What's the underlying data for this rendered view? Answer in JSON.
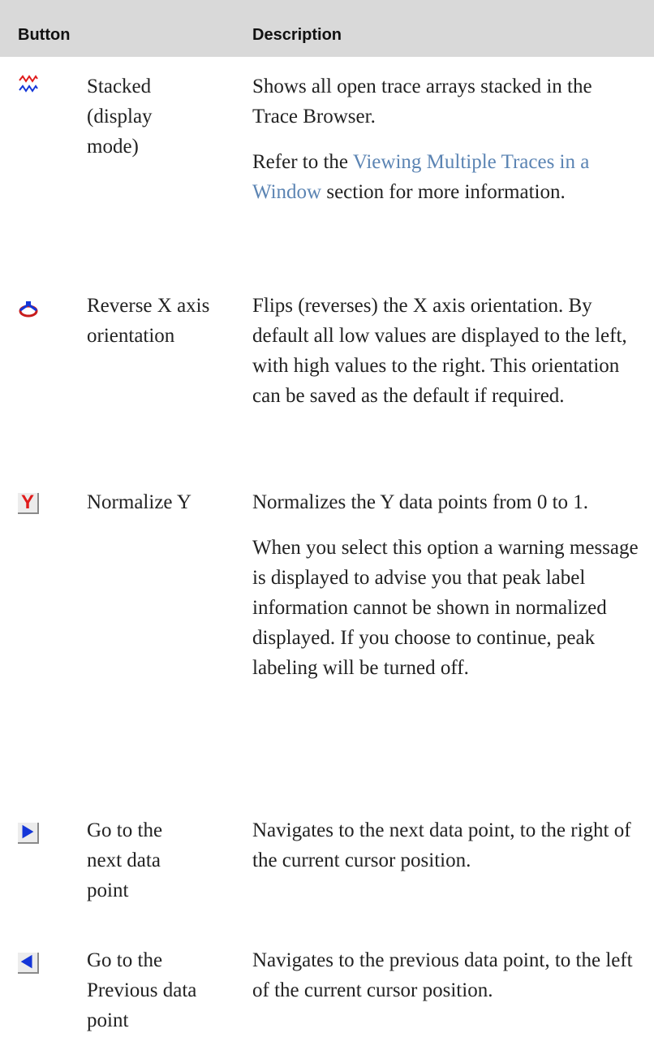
{
  "header": {
    "button": "Button",
    "description": "Description"
  },
  "rows": [
    {
      "icon": "stacked-waves-icon",
      "name_lines": [
        "Stacked",
        "(display",
        "mode)"
      ],
      "desc": [
        "Shows all open trace arrays stacked in the Trace Browser.",
        {
          "before": "Refer to the ",
          "link": "Viewing Multiple Traces in a Window",
          "after": " section for more information."
        }
      ]
    },
    {
      "icon": "reverse-axis-icon",
      "name_lines": [
        "Reverse X axis",
        "orientation"
      ],
      "desc": [
        "Flips (reverses) the X axis orientation. By default all low values are displayed to the left, with high values to the right. This orientation can be saved as the default if required."
      ]
    },
    {
      "icon": "normalize-y-icon",
      "icon_text": "Y",
      "name_lines": [
        "Normalize Y"
      ],
      "desc": [
        "Normalizes the Y data points from 0 to 1.",
        "When you select this option a warning message is displayed to advise you that peak label information cannot be shown in normalized displayed. If you choose to continue, peak labeling will be turned off."
      ]
    },
    {
      "icon": "right-arrow-icon",
      "name_lines": [
        "Go to the",
        "next data",
        "point"
      ],
      "desc": [
        "Navigates to the next data point, to the right of the current cursor position."
      ]
    },
    {
      "icon": "left-arrow-icon",
      "name_lines": [
        "Go to the",
        "Previous data",
        "point"
      ],
      "desc": [
        "Navigates to the previous data point, to the left of the current cursor position."
      ]
    }
  ],
  "colors": {
    "header_bg": "#d9d9d9",
    "link": "#5b84b3",
    "icon_red": "#e01b1b",
    "icon_blue": "#1436d8"
  }
}
